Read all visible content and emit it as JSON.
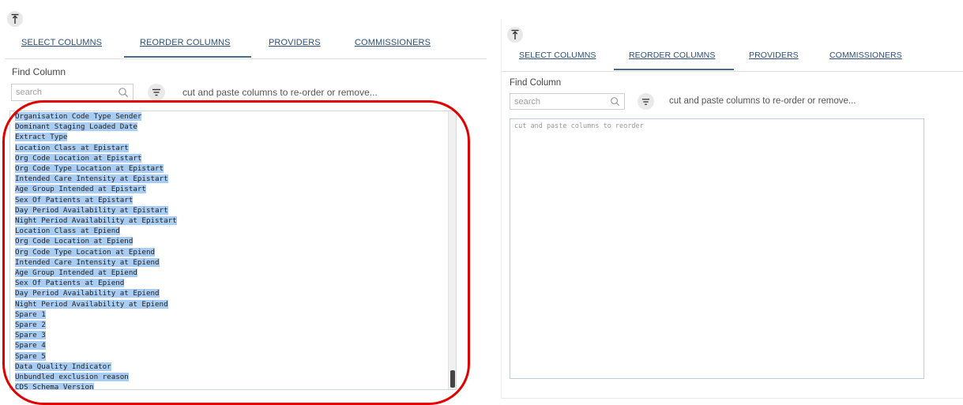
{
  "left": {
    "tabs": [
      "SELECT COLUMNS",
      "REORDER COLUMNS",
      "PROVIDERS",
      "COMMISSIONERS"
    ],
    "active_tab": "REORDER COLUMNS",
    "find_label": "Find Column",
    "search_placeholder": "search",
    "hint": "cut and paste columns to re-order or remove...",
    "columns": [
      "Organisation Code Type Sender",
      "Dominant Staging Loaded Date",
      "Extract Type",
      "Location Class at Epistart",
      "Org Code Location at Epistart",
      "Org Code Type Location at Epistart",
      "Intended Care Intensity at Epistart",
      "Age Group Intended at Epistart",
      "Sex Of Patients at Epistart",
      "Day Period Availability at Epistart",
      "Night Period Availability at Epistart",
      "Location Class at Epiend",
      "Org Code Location at Epiend",
      "Org Code Type Location at Epiend",
      "Intended Care Intensity at Epiend",
      "Age Group Intended at Epiend",
      "Sex Of Patients at Epiend",
      "Day Period Availability at Epiend",
      "Night Period Availability at Epiend",
      "Spare 1",
      "Spare 2",
      "Spare 3",
      "Spare 4",
      "Spare 5",
      "Data Quality Indicator",
      "Unbundled exclusion reason",
      "CDS Schema Version"
    ]
  },
  "right": {
    "tabs": [
      "SELECT COLUMNS",
      "REORDER COLUMNS",
      "PROVIDERS",
      "COMMISSIONERS"
    ],
    "active_tab": "REORDER COLUMNS",
    "find_label": "Find Column",
    "search_placeholder": "search",
    "hint": "cut and paste columns to re-order or remove...",
    "textarea_placeholder": "cut and paste columns to reorder"
  },
  "icons": {
    "collapse": "collapse-top-icon",
    "search": "search-icon",
    "filter": "filter-sort-icon"
  },
  "colors": {
    "selection": "#a9cdf2",
    "annotation_ring": "#e00000",
    "tab_link": "#2b4f7a"
  }
}
